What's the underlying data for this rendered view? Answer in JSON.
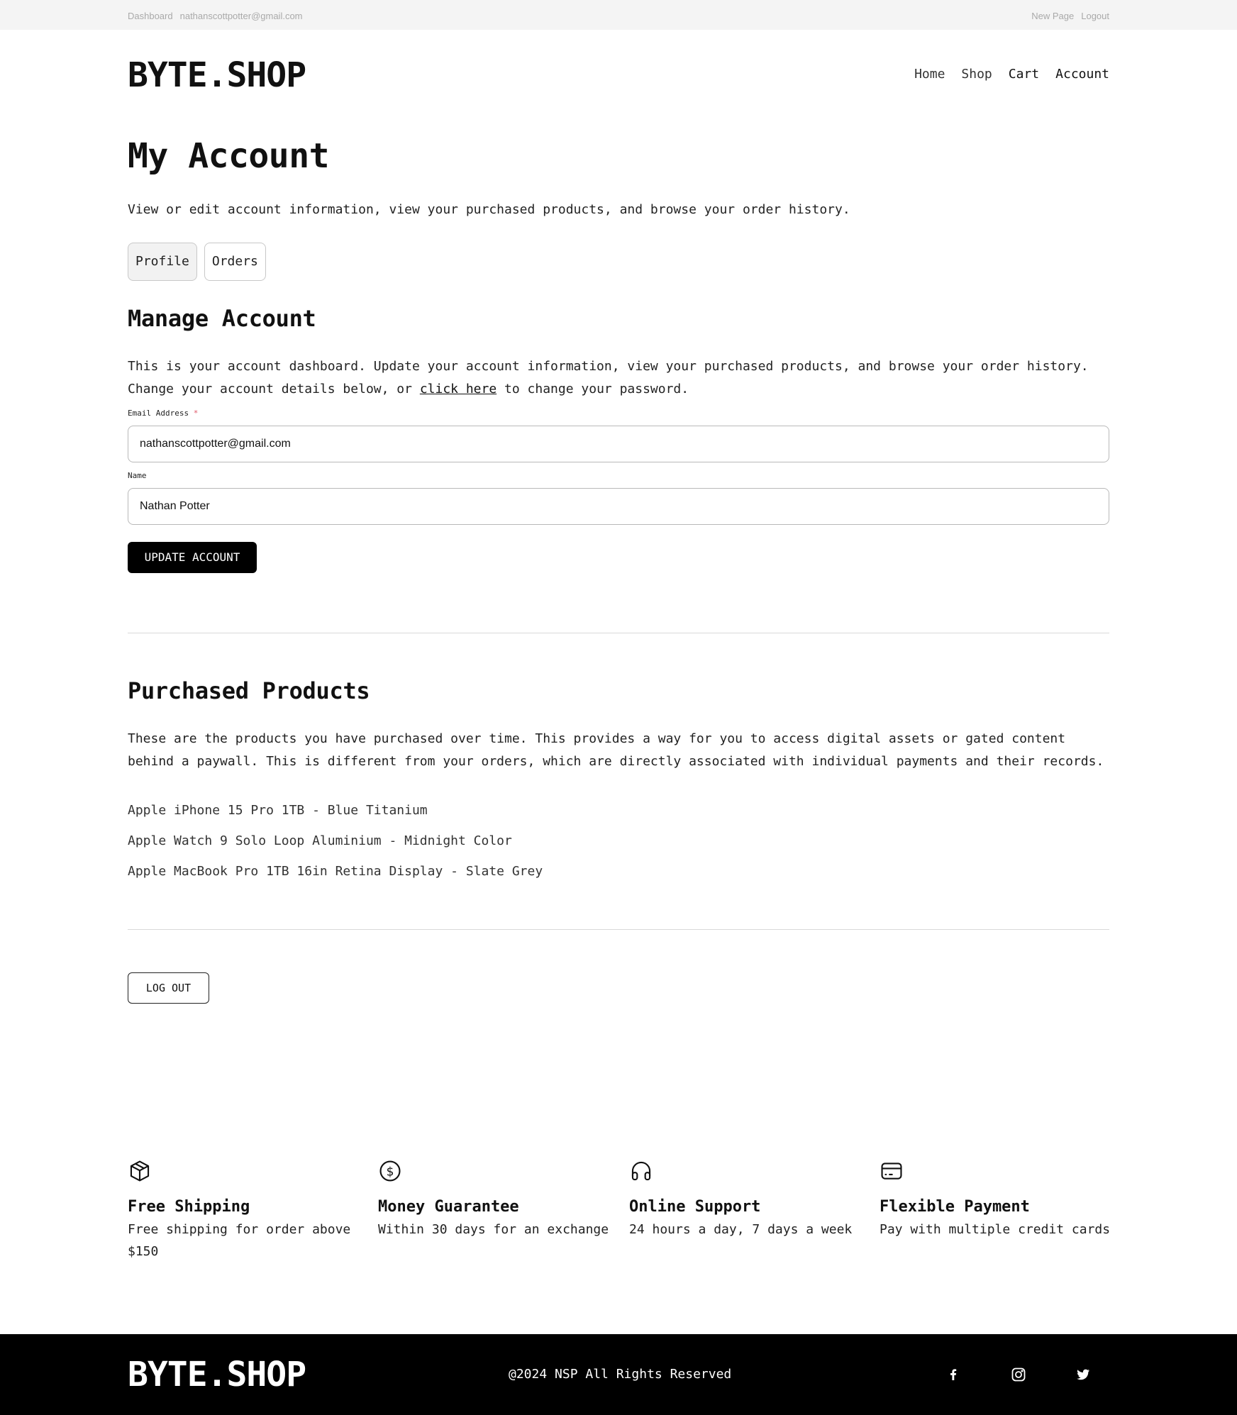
{
  "adminbar": {
    "dashboard": "Dashboard",
    "email": "nathanscottpotter@gmail.com",
    "new_page": "New Page",
    "logout": "Logout"
  },
  "header": {
    "logo": "BYTE.SHOP",
    "nav": [
      "Home",
      "Shop",
      "Cart",
      "Account"
    ]
  },
  "page": {
    "title": "My Account",
    "subtitle": "View or edit account information, view your purchased products, and browse your order history."
  },
  "tabs": [
    {
      "label": "Profile",
      "active": true
    },
    {
      "label": "Orders",
      "active": false
    }
  ],
  "manage": {
    "heading": "Manage Account",
    "line1": "This is your account dashboard. Update your account information, view your purchased products, and browse your order history.",
    "line2_before": "Change your account details below, or ",
    "line2_link": "click here",
    "line2_after": " to change your password.",
    "email_label": "Email Address",
    "required_mark": "*",
    "email_value": "nathanscottpotter@gmail.com",
    "name_label": "Name",
    "name_value": "Nathan Potter",
    "update_button": "UPDATE ACCOUNT"
  },
  "purchased": {
    "heading": "Purchased Products",
    "line1": "These are the products you have purchased over time. This provides a way for you to access digital assets or gated content",
    "line2": "behind a paywall. This is different from your orders, which are directly associated with individual payments and their records.",
    "products": [
      "Apple iPhone 15 Pro 1TB - Blue Titanium",
      "Apple Watch 9 Solo Loop Aluminium - Midnight Color",
      "Apple MacBook Pro 1TB 16in Retina Display - Slate Grey"
    ]
  },
  "logout_button": "LOG OUT",
  "features": [
    {
      "icon": "box-icon",
      "title": "Free Shipping",
      "desc": "Free shipping for order above $150"
    },
    {
      "icon": "dollar-coin-icon",
      "title": "Money Guarantee",
      "desc": "Within 30 days for an exchange"
    },
    {
      "icon": "headphones-icon",
      "title": "Online Support",
      "desc": "24 hours a day, 7 days a week"
    },
    {
      "icon": "credit-card-icon",
      "title": "Flexible Payment",
      "desc": "Pay with multiple credit cards"
    }
  ],
  "footer": {
    "logo": "BYTE.SHOP",
    "copyright": "@2024 NSP All Rights Reserved",
    "social": [
      "facebook-icon",
      "instagram-icon",
      "twitter-icon"
    ]
  }
}
